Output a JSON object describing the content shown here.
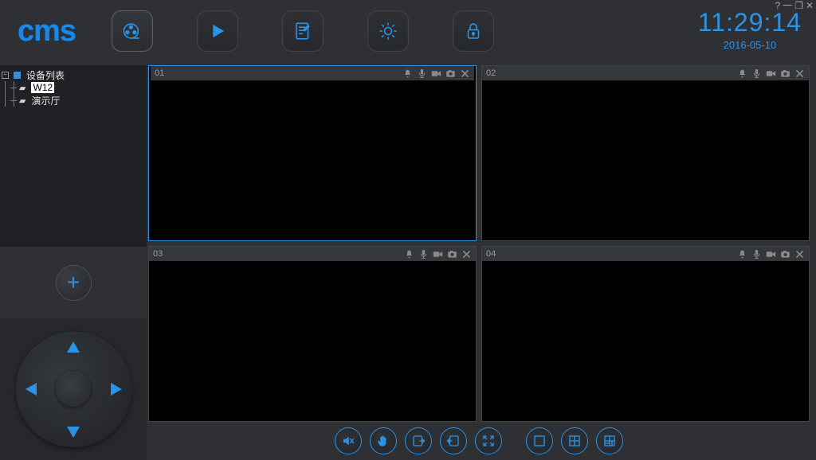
{
  "window_controls": {
    "help": "?",
    "min": "一",
    "max": "❐",
    "close": "✕"
  },
  "logo": "cms",
  "toolbar": [
    {
      "name": "liveview-button",
      "icon": "reel",
      "active": true
    },
    {
      "name": "playback-button",
      "icon": "play",
      "active": false
    },
    {
      "name": "log-button",
      "icon": "note",
      "active": false
    },
    {
      "name": "settings-button",
      "icon": "gear",
      "active": false
    },
    {
      "name": "lock-button",
      "icon": "lock",
      "active": false
    }
  ],
  "clock": {
    "time": "11:29:14",
    "date": "2016-05-10"
  },
  "tree": {
    "root_label": "设备列表",
    "items": [
      {
        "label": "W12",
        "selected": true
      },
      {
        "label": "演示厅",
        "selected": false
      }
    ]
  },
  "add_label": "+",
  "cells": [
    {
      "num": "01",
      "selected": true
    },
    {
      "num": "02",
      "selected": false
    },
    {
      "num": "03",
      "selected": false
    },
    {
      "num": "04",
      "selected": false
    }
  ],
  "bottom": [
    {
      "name": "mute-button",
      "icon": "mute",
      "gap": false
    },
    {
      "name": "hand-button",
      "icon": "hand",
      "gap": false
    },
    {
      "name": "prev-group-button",
      "icon": "pgout",
      "gap": false
    },
    {
      "name": "next-group-button",
      "icon": "pgin",
      "gap": false
    },
    {
      "name": "fullscreen-button",
      "icon": "expand",
      "gap": false
    },
    {
      "name": "layout-1-button",
      "icon": "sq1",
      "gap": true
    },
    {
      "name": "layout-4-button",
      "icon": "sq4",
      "gap": false
    },
    {
      "name": "layout-more-button",
      "icon": "sqN",
      "gap": false
    }
  ]
}
